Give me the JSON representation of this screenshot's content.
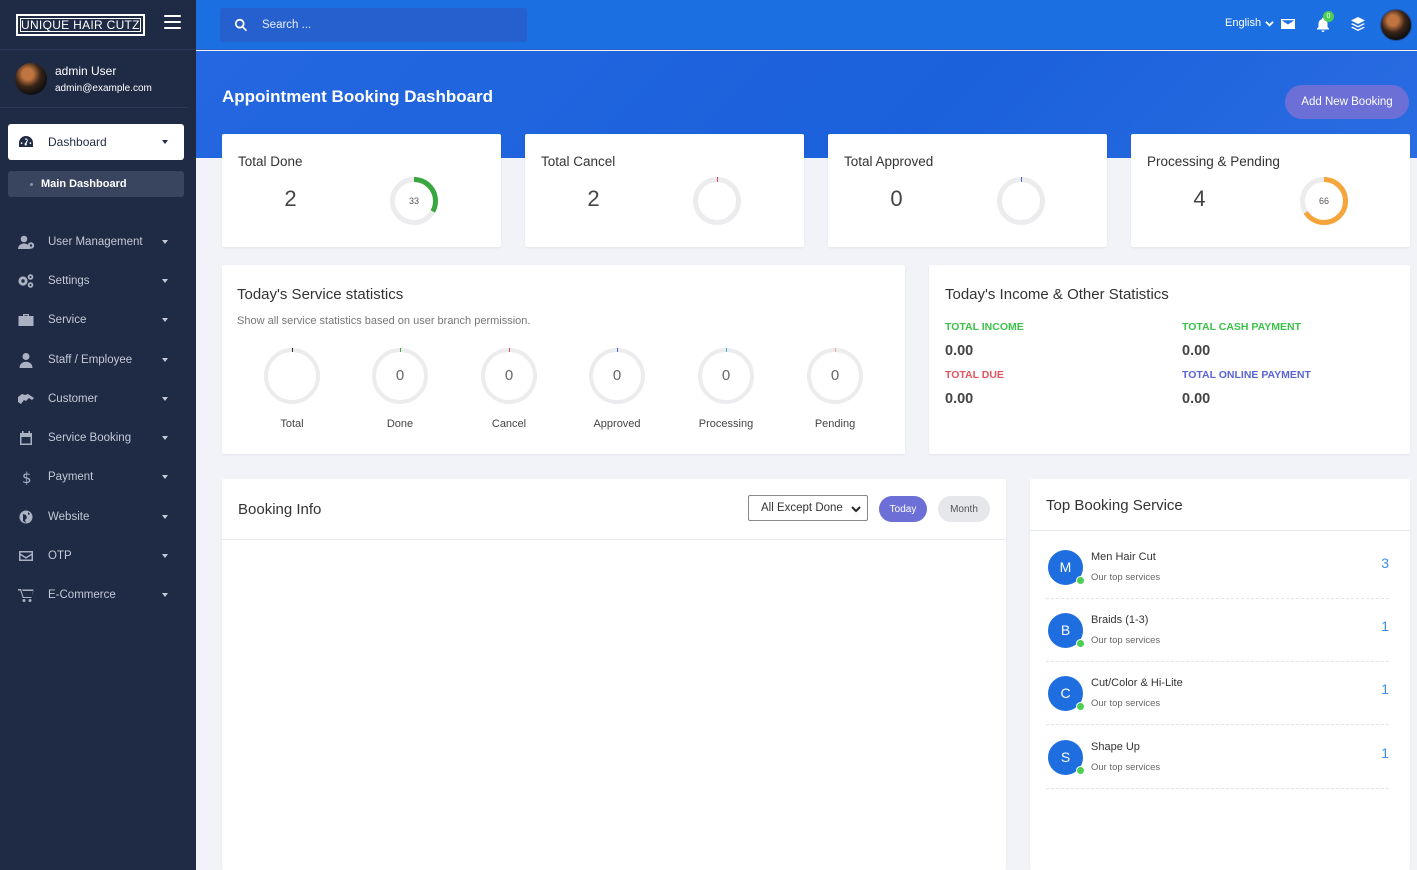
{
  "app": {
    "logo_text": "UNIQUE HAIR CUTZ"
  },
  "user": {
    "name": "admin User",
    "email": "admin@example.com"
  },
  "sidebar": {
    "dashboard_label": "Dashboard",
    "sub_item": "Main Dashboard",
    "items": [
      {
        "label": "User Management",
        "icon": "users-icon"
      },
      {
        "label": "Settings",
        "icon": "gears-icon"
      },
      {
        "label": "Service",
        "icon": "briefcase-icon"
      },
      {
        "label": "Staff / Employee",
        "icon": "staff-icon"
      },
      {
        "label": "Customer",
        "icon": "handshake-icon"
      },
      {
        "label": "Service Booking",
        "icon": "calendar-icon"
      },
      {
        "label": "Payment",
        "icon": "dollar-icon"
      },
      {
        "label": "Website",
        "icon": "globe-icon"
      },
      {
        "label": "OTP",
        "icon": "envelope-icon"
      },
      {
        "label": "E-Commerce",
        "icon": "cart-icon"
      }
    ]
  },
  "topbar": {
    "search_placeholder": "Search ...",
    "language": "English",
    "notification_count": "0"
  },
  "header": {
    "title": "Appointment Booking Dashboard",
    "add_button": "Add New Booking"
  },
  "stats": [
    {
      "label": "Total Done",
      "value": "2",
      "ring_value": "33",
      "ring_percent": 33,
      "color": "#3aa63f"
    },
    {
      "label": "Total Cancel",
      "value": "2",
      "ring_value": "",
      "ring_percent": 0,
      "color": "#e0434a"
    },
    {
      "label": "Total Approved",
      "value": "0",
      "ring_value": "",
      "ring_percent": 0,
      "color": "#3d64d6"
    },
    {
      "label": "Processing & Pending",
      "value": "4",
      "ring_value": "66",
      "ring_percent": 66,
      "color": "#f5a53a"
    }
  ],
  "service_stats": {
    "title": "Today's Service statistics",
    "subtitle": "Show all service statistics based on user branch permission.",
    "items": [
      {
        "label": "Total",
        "value": "",
        "color": "#222222"
      },
      {
        "label": "Done",
        "value": "0",
        "color": "#3aa63f"
      },
      {
        "label": "Cancel",
        "value": "0",
        "color": "#e0434a"
      },
      {
        "label": "Approved",
        "value": "0",
        "color": "#3d64d6"
      },
      {
        "label": "Processing",
        "value": "0",
        "color": "#3ba9d8"
      },
      {
        "label": "Pending",
        "value": "0",
        "color": "#f5a67a"
      }
    ]
  },
  "income": {
    "title": "Today's Income & Other Statistics",
    "total_income_label": "TOTAL INCOME",
    "total_income": "0.00",
    "total_cash_label": "TOTAL CASH PAYMENT",
    "total_cash": "0.00",
    "total_due_label": "TOTAL DUE",
    "total_due": "0.00",
    "total_online_label": "TOTAL ONLINE PAYMENT",
    "total_online": "0.00",
    "colors": {
      "income": "#3cc24a",
      "cash": "#3cc24a",
      "due": "#e4555d",
      "online": "#5a64d6"
    }
  },
  "booking": {
    "title": "Booking Info",
    "filter_selected": "All Except Done",
    "today_label": "Today",
    "month_label": "Month"
  },
  "top_services": {
    "title": "Top Booking Service",
    "items": [
      {
        "initial": "M",
        "name": "Men Hair Cut",
        "sub": "Our top services",
        "count": "3"
      },
      {
        "initial": "B",
        "name": "Braids (1-3)",
        "sub": "Our top services",
        "count": "1"
      },
      {
        "initial": "C",
        "name": "Cut/Color & Hi-Lite",
        "sub": "Our top services",
        "count": "1"
      },
      {
        "initial": "S",
        "name": "Shape Up",
        "sub": "Our top services",
        "count": "1"
      }
    ]
  }
}
